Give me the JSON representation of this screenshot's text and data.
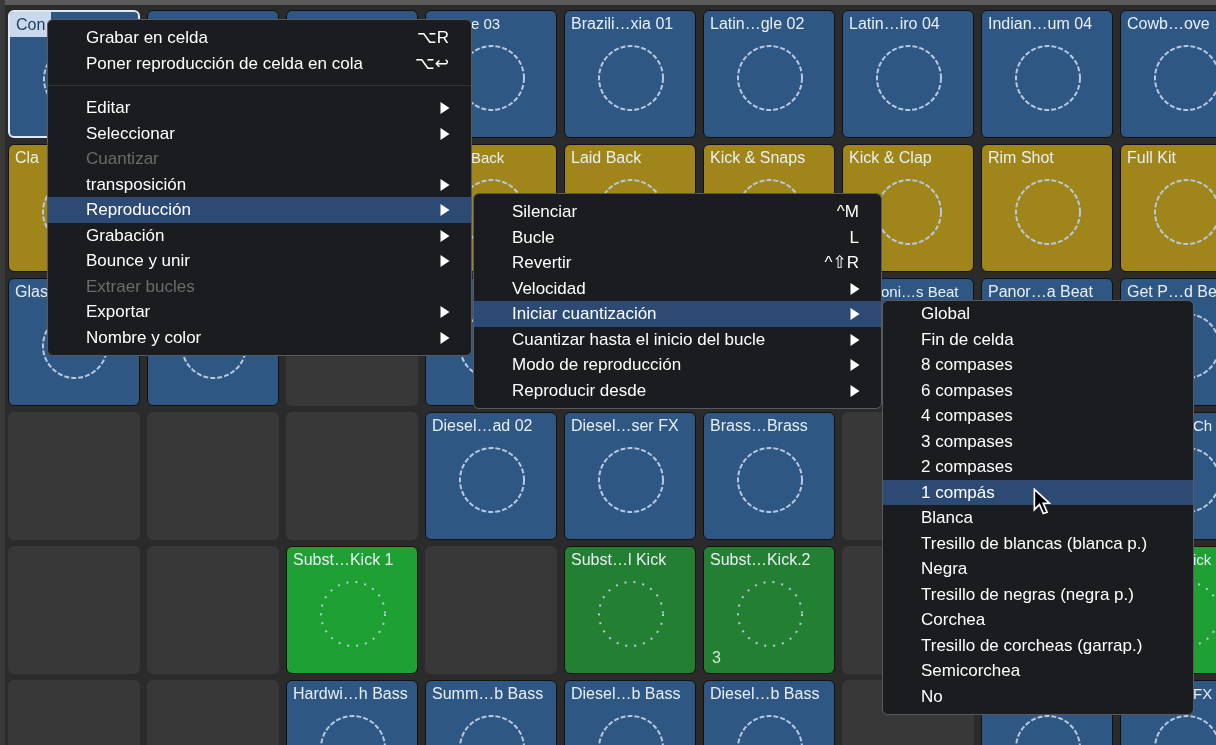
{
  "grid": {
    "rows": [
      {
        "cells": [
          {
            "kind": "clip",
            "label": "Con",
            "color": "#2f5783",
            "selected": true
          },
          {
            "kind": "clip",
            "color": "#2f5783",
            "selected": false
          },
          {
            "kind": "clip",
            "color": "#2f5783",
            "selected": false
          },
          {
            "kind": "clip",
            "label": "e 03",
            "clip_left": true,
            "color": "#2f5783",
            "selected": false
          },
          {
            "kind": "clip",
            "label": "Brazili…xia 01",
            "color": "#2f5783",
            "selected": false
          },
          {
            "kind": "clip",
            "label": "Latin…gle 02",
            "color": "#2f5783",
            "selected": false
          },
          {
            "kind": "clip",
            "label": "Latin…iro 04",
            "color": "#2f5783",
            "selected": false
          },
          {
            "kind": "clip",
            "label": "Indian…um 04",
            "color": "#2f5783",
            "selected": false
          },
          {
            "kind": "clip",
            "label": "Cowb…ove",
            "color": "#2f5783",
            "selected": false
          }
        ]
      },
      {
        "cells": [
          {
            "kind": "clip",
            "label": "Cla",
            "color": "#a0861a",
            "selected": false
          },
          {
            "kind": "hidden"
          },
          {
            "kind": "hidden"
          },
          {
            "kind": "clip",
            "label": "Back",
            "clip_left": true,
            "color": "#a0861a",
            "selected": false
          },
          {
            "kind": "clip",
            "label": "Laid Back",
            "color": "#a0861a",
            "selected": false
          },
          {
            "kind": "clip",
            "label": "Kick & Snaps",
            "color": "#a0861a",
            "selected": false
          },
          {
            "kind": "clip",
            "label": "Kick & Clap",
            "color": "#a0861a",
            "selected": false
          },
          {
            "kind": "clip",
            "label": "Rim Shot",
            "color": "#a0861a",
            "selected": false
          },
          {
            "kind": "clip",
            "label": "Full Kit",
            "color": "#a0861a",
            "selected": false
          }
        ]
      },
      {
        "cells": [
          {
            "kind": "clip",
            "label": "Glas",
            "color": "#2f5783",
            "selected": false
          },
          {
            "kind": "clip",
            "color": "#2f5783",
            "selected": false
          },
          {
            "kind": "empty"
          },
          {
            "kind": "clip",
            "color": "#2f5783",
            "selected": false
          },
          {
            "kind": "hidden"
          },
          {
            "kind": "hidden"
          },
          {
            "kind": "clip",
            "label": "oni…s Beat",
            "clip_left": true,
            "color": "#2f5783",
            "selected": false
          },
          {
            "kind": "clip",
            "label": "Panor…a Beat",
            "color": "#2f5783",
            "selected": false
          },
          {
            "kind": "clip",
            "label": "Get P…d Be",
            "color": "#2f5783",
            "selected": false
          }
        ]
      },
      {
        "cells": [
          {
            "kind": "empty"
          },
          {
            "kind": "empty"
          },
          {
            "kind": "empty"
          },
          {
            "kind": "clip",
            "label": "Diesel…ad 02",
            "color": "#2f5783",
            "selected": false
          },
          {
            "kind": "clip",
            "label": "Diesel…ser FX",
            "color": "#2f5783",
            "selected": false
          },
          {
            "kind": "clip",
            "label": "Brass…Brass",
            "color": "#2f5783",
            "selected": false
          },
          {
            "kind": "empty"
          },
          {
            "kind": "hidden"
          },
          {
            "kind": "clip",
            "label": "Ch",
            "clip_left": true,
            "color": "#2f5783",
            "selected": false
          }
        ]
      },
      {
        "cells": [
          {
            "kind": "empty"
          },
          {
            "kind": "empty"
          },
          {
            "kind": "clip",
            "label": "Subst…Kick 1",
            "color": "#1fa032",
            "selected": false
          },
          {
            "kind": "empty"
          },
          {
            "kind": "clip",
            "label": "Subst…l Kick",
            "color": "#237f32",
            "selected": false
          },
          {
            "kind": "clip",
            "label": "Subst…Kick.2",
            "color": "#237f32",
            "selected": false,
            "count": "3"
          },
          {
            "kind": "empty"
          },
          {
            "kind": "hidden"
          },
          {
            "kind": "clip",
            "label": "ick",
            "clip_left": true,
            "color": "#1fa032",
            "selected": false
          }
        ]
      },
      {
        "cells": [
          {
            "kind": "empty"
          },
          {
            "kind": "empty"
          },
          {
            "kind": "clip",
            "label": "Hardwi…h Bass",
            "color": "#2f5783",
            "selected": false
          },
          {
            "kind": "clip",
            "label": "Summ…b Bass",
            "color": "#2f5783",
            "selected": false
          },
          {
            "kind": "clip",
            "label": "Diesel…b Bass",
            "color": "#2f5783",
            "selected": false
          },
          {
            "kind": "clip",
            "label": "Diesel…b Bass",
            "color": "#2f5783",
            "selected": false
          },
          {
            "kind": "empty"
          },
          {
            "kind": "clip",
            "color": "#2f5783",
            "selected": false
          },
          {
            "kind": "clip",
            "label": "FX",
            "clip_left": true,
            "color": "#2f5783",
            "selected": false
          }
        ]
      }
    ]
  },
  "menus": [
    {
      "items": [
        {
          "kind": "item",
          "label": "Grabar en celda",
          "shortcut": "⌥R",
          "submenu": false,
          "disabled": false,
          "selected": false
        },
        {
          "kind": "item",
          "label": "Poner reproducción de celda en cola",
          "shortcut": "⌥↩",
          "submenu": false,
          "disabled": false,
          "selected": false
        },
        {
          "kind": "separator"
        },
        {
          "kind": "item",
          "label": "Editar",
          "submenu": true,
          "disabled": false,
          "selected": false
        },
        {
          "kind": "item",
          "label": "Seleccionar",
          "submenu": true,
          "disabled": false,
          "selected": false
        },
        {
          "kind": "item",
          "label": "Cuantizar",
          "submenu": false,
          "disabled": true,
          "selected": false
        },
        {
          "kind": "item",
          "label": "transposición",
          "submenu": true,
          "disabled": false,
          "selected": false
        },
        {
          "kind": "item",
          "label": "Reproducción",
          "submenu": true,
          "disabled": false,
          "selected": true
        },
        {
          "kind": "item",
          "label": "Grabación",
          "submenu": true,
          "disabled": false,
          "selected": false
        },
        {
          "kind": "item",
          "label": "Bounce y unir",
          "submenu": true,
          "disabled": false,
          "selected": false
        },
        {
          "kind": "item",
          "label": "Extraer bucles",
          "submenu": false,
          "disabled": true,
          "selected": false
        },
        {
          "kind": "item",
          "label": "Exportar",
          "submenu": true,
          "disabled": false,
          "selected": false
        },
        {
          "kind": "item",
          "label": "Nombre y color",
          "submenu": true,
          "disabled": false,
          "selected": false
        }
      ]
    },
    {
      "items": [
        {
          "kind": "item",
          "label": "Silenciar",
          "shortcut": "^M",
          "submenu": false,
          "disabled": false,
          "selected": false
        },
        {
          "kind": "item",
          "label": "Bucle",
          "shortcut": "L",
          "submenu": false,
          "disabled": false,
          "selected": false
        },
        {
          "kind": "item",
          "label": "Revertir",
          "shortcut": "^⇧R",
          "submenu": false,
          "disabled": false,
          "selected": false
        },
        {
          "kind": "item",
          "label": "Velocidad",
          "submenu": true,
          "disabled": false,
          "selected": false
        },
        {
          "kind": "item",
          "label": "Iniciar cuantización",
          "submenu": true,
          "disabled": false,
          "selected": true
        },
        {
          "kind": "item",
          "label": "Cuantizar hasta el inicio del bucle",
          "submenu": true,
          "disabled": false,
          "selected": false
        },
        {
          "kind": "item",
          "label": "Modo de reproducción",
          "submenu": true,
          "disabled": false,
          "selected": false
        },
        {
          "kind": "item",
          "label": "Reproducir desde",
          "submenu": true,
          "disabled": false,
          "selected": false
        }
      ]
    },
    {
      "items": [
        {
          "kind": "item",
          "label": "Global",
          "submenu": false,
          "disabled": false,
          "selected": false
        },
        {
          "kind": "item",
          "label": "Fin de celda",
          "submenu": false,
          "disabled": false,
          "selected": false
        },
        {
          "kind": "item",
          "label": "8 compases",
          "submenu": false,
          "disabled": false,
          "selected": false
        },
        {
          "kind": "item",
          "label": "6 compases",
          "submenu": false,
          "disabled": false,
          "selected": false
        },
        {
          "kind": "item",
          "label": "4 compases",
          "submenu": false,
          "disabled": false,
          "selected": false
        },
        {
          "kind": "item",
          "label": "3 compases",
          "submenu": false,
          "disabled": false,
          "selected": false
        },
        {
          "kind": "item",
          "label": "2 compases",
          "submenu": false,
          "disabled": false,
          "selected": false
        },
        {
          "kind": "item",
          "label": "1 compás",
          "submenu": false,
          "disabled": false,
          "selected": true
        },
        {
          "kind": "item",
          "label": "Blanca",
          "submenu": false,
          "disabled": false,
          "selected": false
        },
        {
          "kind": "item",
          "label": "Tresillo de blancas (blanca p.)",
          "submenu": false,
          "disabled": false,
          "selected": false
        },
        {
          "kind": "item",
          "label": "Negra",
          "submenu": false,
          "disabled": false,
          "selected": false
        },
        {
          "kind": "item",
          "label": "Tresillo de negras (negra p.)",
          "submenu": false,
          "disabled": false,
          "selected": false
        },
        {
          "kind": "item",
          "label": "Corchea",
          "submenu": false,
          "disabled": false,
          "selected": false
        },
        {
          "kind": "item",
          "label": "Tresillo de corcheas (garrap.)",
          "submenu": false,
          "disabled": false,
          "selected": false
        },
        {
          "kind": "item",
          "label": "Semicorchea",
          "submenu": false,
          "disabled": false,
          "selected": false
        },
        {
          "kind": "item",
          "label": "No",
          "submenu": false,
          "disabled": false,
          "selected": false
        }
      ]
    }
  ]
}
